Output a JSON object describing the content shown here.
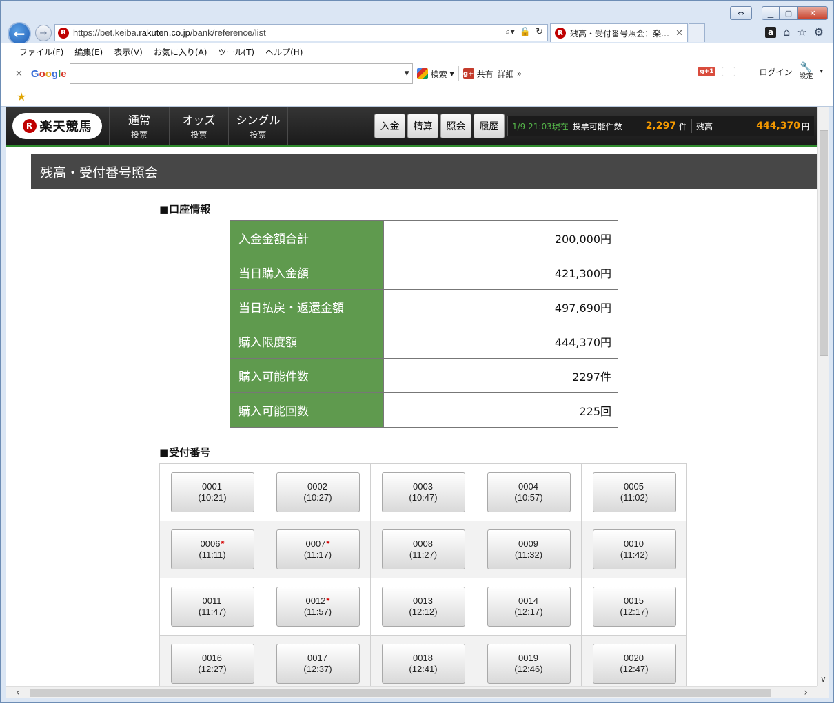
{
  "browser": {
    "url_prefix": "https://bet.keiba.",
    "url_domain": "rakuten.co.jp",
    "url_path": "/bank/reference/list",
    "tab_title": "残高・受付番号照会：楽…",
    "menu": [
      "ファイル(F)",
      "編集(E)",
      "表示(V)",
      "お気に入り(A)",
      "ツール(T)",
      "ヘルプ(H)"
    ],
    "google_toolbar": {
      "search_label": "検索",
      "share_label": "共有",
      "details_label": "詳細",
      "login_label": "ログイン",
      "settings_label": "設定"
    }
  },
  "site": {
    "brand_name": "楽天競馬",
    "nav": [
      {
        "main": "通常",
        "sub": "投票"
      },
      {
        "main": "オッズ",
        "sub": "投票"
      },
      {
        "main": "シングル",
        "sub": "投票"
      }
    ],
    "header_buttons": [
      "入金",
      "精算",
      "照会",
      "履歴"
    ],
    "status": {
      "time": "1/9 21:03現在",
      "count_label": "投票可能件数",
      "count_value": "2,297",
      "count_unit": "件",
      "balance_label": "残高",
      "balance_value": "444,370",
      "balance_unit": "円"
    }
  },
  "page": {
    "title": "残高・受付番号照会",
    "account_heading": "■口座情報",
    "account_rows": [
      {
        "label": "入金金額合計",
        "value": "200,000円"
      },
      {
        "label": "当日購入金額",
        "value": "421,300円"
      },
      {
        "label": "当日払戻・返還金額",
        "value": "497,690円"
      },
      {
        "label": "購入限度額",
        "value": "444,370円"
      },
      {
        "label": "購入可能件数",
        "value": "2297件"
      },
      {
        "label": "購入可能回数",
        "value": "225回"
      }
    ],
    "receipt_heading": "■受付番号",
    "receipts": [
      {
        "no": "0001",
        "time": "(10:21)",
        "mark": ""
      },
      {
        "no": "0002",
        "time": "(10:27)",
        "mark": ""
      },
      {
        "no": "0003",
        "time": "(10:47)",
        "mark": ""
      },
      {
        "no": "0004",
        "time": "(10:57)",
        "mark": ""
      },
      {
        "no": "0005",
        "time": "(11:02)",
        "mark": ""
      },
      {
        "no": "0006",
        "time": "(11:11)",
        "mark": "*"
      },
      {
        "no": "0007",
        "time": "(11:17)",
        "mark": "*"
      },
      {
        "no": "0008",
        "time": "(11:27)",
        "mark": ""
      },
      {
        "no": "0009",
        "time": "(11:32)",
        "mark": ""
      },
      {
        "no": "0010",
        "time": "(11:42)",
        "mark": ""
      },
      {
        "no": "0011",
        "time": "(11:47)",
        "mark": ""
      },
      {
        "no": "0012",
        "time": "(11:57)",
        "mark": "*"
      },
      {
        "no": "0013",
        "time": "(12:12)",
        "mark": ""
      },
      {
        "no": "0014",
        "time": "(12:17)",
        "mark": ""
      },
      {
        "no": "0015",
        "time": "(12:17)",
        "mark": ""
      },
      {
        "no": "0016",
        "time": "(12:27)",
        "mark": ""
      },
      {
        "no": "0017",
        "time": "(12:37)",
        "mark": ""
      },
      {
        "no": "0018",
        "time": "(12:41)",
        "mark": ""
      },
      {
        "no": "0019",
        "time": "(12:46)",
        "mark": ""
      },
      {
        "no": "0020",
        "time": "(12:47)",
        "mark": ""
      }
    ]
  },
  "colors": {
    "brand_red": "#bf0000",
    "label_green": "#5f9a4e",
    "accent_orange": "#f39800",
    "header_dark": "#1b1b1b",
    "title_gray": "#474747",
    "mark_red": "#d40000"
  }
}
